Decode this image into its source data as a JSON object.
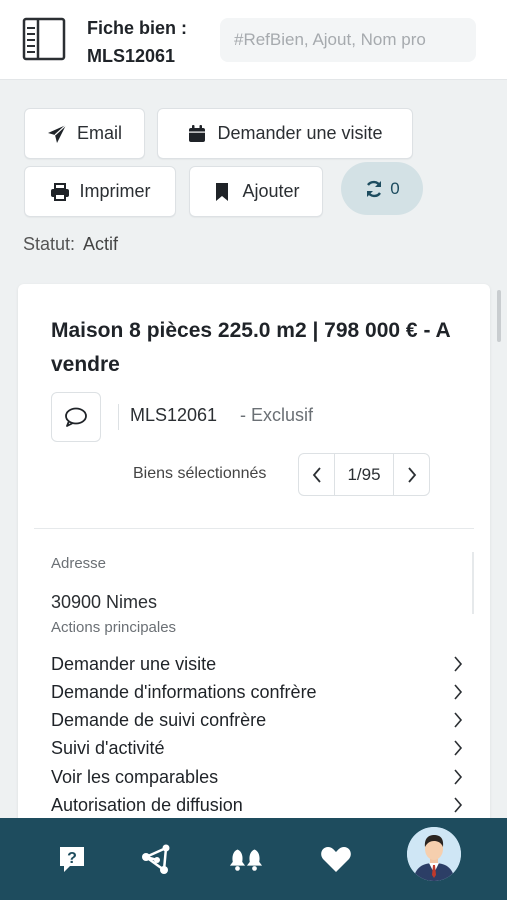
{
  "header": {
    "title_line1": "Fiche bien :",
    "title_line2": "MLS12061",
    "search_placeholder": "#RefBien, Ajout, Nom pro"
  },
  "toolbar": {
    "email_label": "Email",
    "visit_label": "Demander une visite",
    "print_label": "Imprimer",
    "add_label": "Ajouter",
    "sync_count": "0"
  },
  "status": {
    "label": "Statut:",
    "value": "Actif"
  },
  "property": {
    "heading": "Maison 8 pièces 225.0 m2 | 798 000 € - A vendre",
    "ref": "MLS12061",
    "mandate": "- Exclusif",
    "selection_label": "Biens sélectionnés",
    "pager_value": "1/95",
    "address_label": "Adresse",
    "address_value": "30900 Nimes",
    "actions_label": "Actions principales",
    "actions": [
      "Demander une visite",
      "Demande d'informations confrère",
      "Demande de suivi confrère",
      "Suivi d'activité",
      "Voir les comparables",
      "Autorisation de diffusion"
    ]
  },
  "icons": {
    "email": "paper-plane-icon",
    "visit": "calendar-icon",
    "print": "printer-icon",
    "add": "bookmark-icon",
    "sync": "sync-icon",
    "comment": "comment-icon",
    "nav": [
      "help-icon",
      "network-icon",
      "bell-icon",
      "heart-icon",
      "avatar"
    ]
  },
  "colors": {
    "nav_background": "#1e4c5e",
    "sync_background": "#d3e1e5",
    "page_background": "#eef1f2"
  }
}
